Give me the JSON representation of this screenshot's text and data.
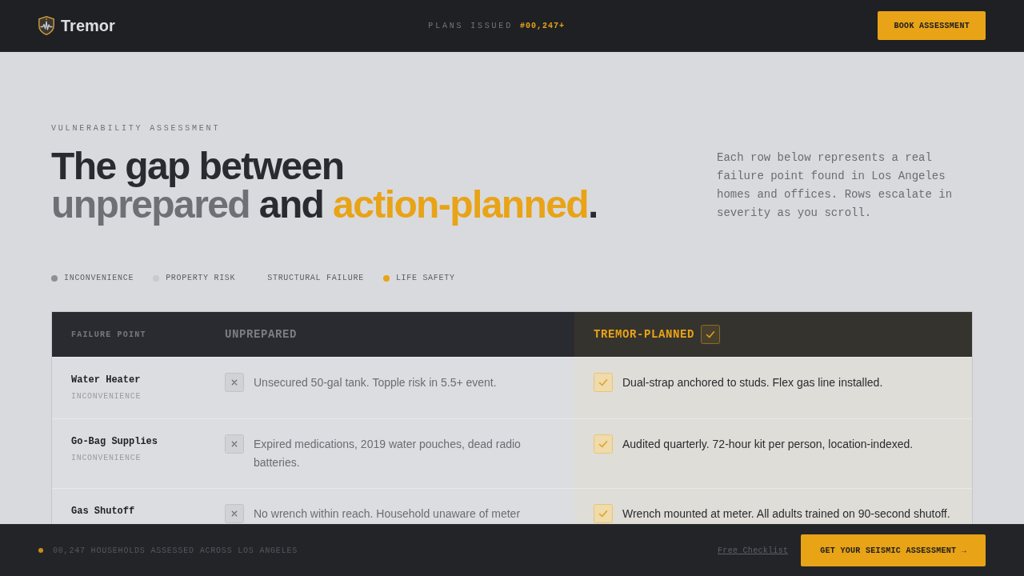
{
  "header": {
    "brand": "Tremor",
    "counter_label": "PLANS ISSUED",
    "counter_value": "#00,247+",
    "cta": "BOOK ASSESSMENT"
  },
  "hero": {
    "kicker": "VULNERABILITY ASSESSMENT",
    "headline": [
      [
        {
          "text": "The gap between",
          "kind": "plain"
        }
      ],
      [
        {
          "text": "unprepared",
          "kind": "muted"
        },
        {
          "text": " and ",
          "kind": "plain"
        },
        {
          "text": "action-planned",
          "kind": "accent"
        },
        {
          "text": ".",
          "kind": "plain"
        }
      ]
    ],
    "intro": "Each row below represents a real failure point found in Los Angeles homes and offices. Rows escalate in severity as you scroll."
  },
  "legend": [
    {
      "label": "INCONVENIENCE",
      "color": "#8e8f93"
    },
    {
      "label": "PROPERTY RISK",
      "color": "#c9cacd"
    },
    {
      "label": "STRUCTURAL FAILURE"
    },
    {
      "label": "LIFE SAFETY",
      "color": "#e8a317"
    }
  ],
  "table": {
    "columns": [
      {
        "label": "FAILURE POINT",
        "kind": "item"
      },
      {
        "label": "UNPREPARED",
        "kind": "unprepared"
      },
      {
        "label": "TREMOR-PLANNED",
        "kind": "planned"
      }
    ],
    "rows": [
      {
        "name": "Water Heater",
        "severity": "INCONVENIENCE",
        "unprepared": "Unsecured 50-gal tank. Topple risk in 5.5+ event.",
        "planned": "Dual-strap anchored to studs. Flex gas line installed."
      },
      {
        "name": "Go-Bag Supplies",
        "severity": "INCONVENIENCE",
        "unprepared": "Expired medications, 2019 water pouches, dead radio batteries.",
        "planned": "Audited quarterly. 72-hour kit per person, location-indexed."
      },
      {
        "name": "Gas Shutoff",
        "unprepared": "No wrench within reach. Household unaware of meter",
        "planned": "Wrench mounted at meter. All adults trained on 90-second shutoff."
      }
    ]
  },
  "footer": {
    "stat": "00,247 HOUSEHOLDS ASSESSED ACROSS LOS ANGELES",
    "link": "Free Checklist",
    "cta": "GET YOUR SEISMIC ASSESSMENT →"
  }
}
